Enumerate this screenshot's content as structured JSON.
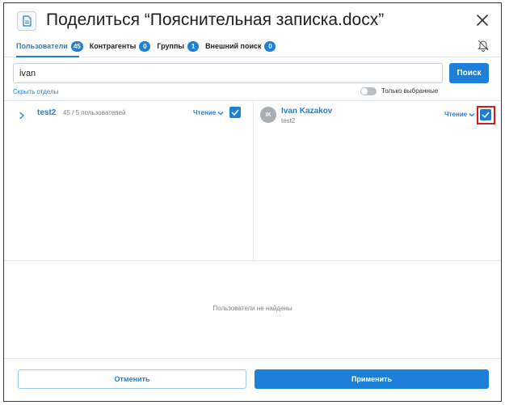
{
  "dialog": {
    "title": "Поделиться “Пояснительная записка.docx”",
    "doc_icon": "document-icon",
    "close_icon": "close-icon",
    "notify_icon": "bell-off-icon"
  },
  "tabs": [
    {
      "label": "Пользователи",
      "count": "45",
      "active": true
    },
    {
      "label": "Контрагенты",
      "count": "0",
      "active": false
    },
    {
      "label": "Группы",
      "count": "1",
      "active": false
    },
    {
      "label": "Внешний поиск",
      "count": "0",
      "active": false
    }
  ],
  "search": {
    "value": "ivan",
    "button_label": "Поиск"
  },
  "filters": {
    "hide_departments_label": "Скрыть отделы",
    "only_selected_label": "Только выбранные",
    "only_selected_on": false
  },
  "left_pane": {
    "group": {
      "name": "test2",
      "count_text": "45 / 5 пользователей",
      "permission": "Чтение",
      "checked": true
    }
  },
  "right_pane": {
    "user": {
      "initials": "IK",
      "name": "Ivan Kazakov",
      "subtitle": "test2",
      "permission": "Чтение",
      "checked": true
    }
  },
  "empty_state": {
    "message": "Пользователи не найдены"
  },
  "footer": {
    "cancel_label": "Отменить",
    "apply_label": "Применить"
  },
  "colors": {
    "accent": "#1e7fd8",
    "highlight": "#d7191c",
    "muted": "#7a7f87"
  }
}
